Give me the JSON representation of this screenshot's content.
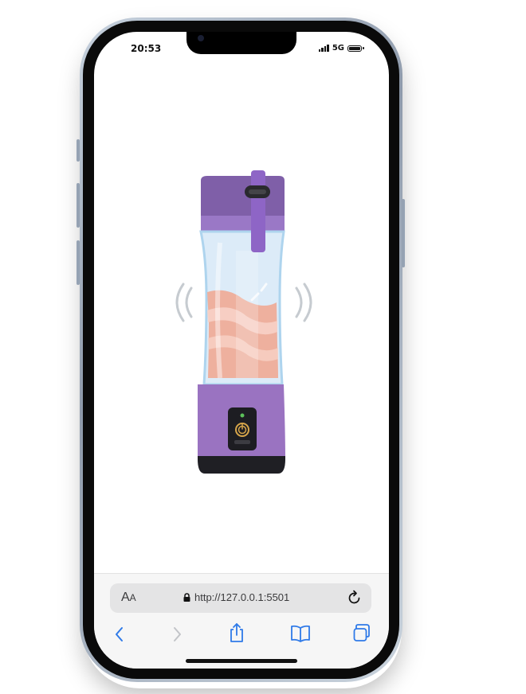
{
  "status_bar": {
    "time": "20:53",
    "network": "5G"
  },
  "browser": {
    "text_size_label_big": "A",
    "text_size_label_small": "A",
    "url": "http://127.0.0.1:5501"
  },
  "illustration": {
    "subject": "portable blender",
    "colors": {
      "body": "#9a73c1",
      "lid": "#7f5fa8",
      "juice": "#eeb09e",
      "jar": "#dcebf8",
      "power_light": "#5cc15a"
    }
  },
  "icons": {
    "back": "chevron-left-icon",
    "forward": "chevron-right-icon",
    "share": "share-icon",
    "bookmarks": "book-icon",
    "tabs": "tabs-icon",
    "reload": "reload-icon",
    "lock": "lock-icon"
  }
}
